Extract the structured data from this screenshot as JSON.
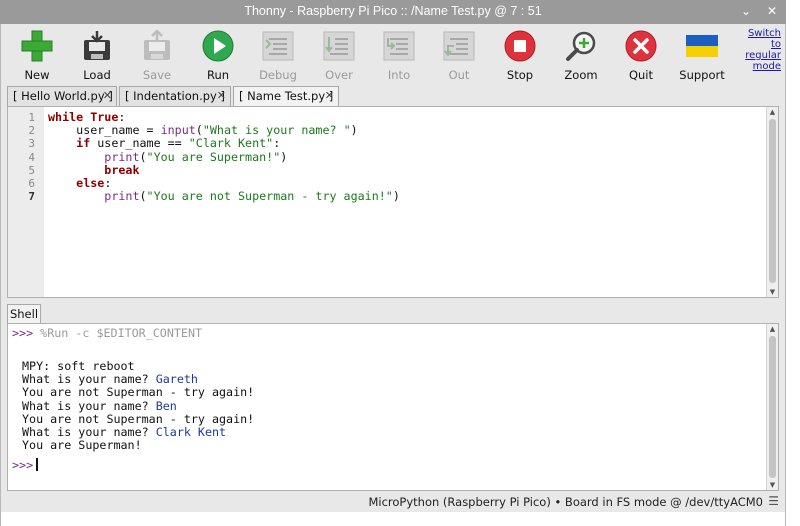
{
  "window": {
    "title": "Thonny  -  Raspberry Pi Pico :: /Name Test.py  @  7 : 51",
    "minimize_glyph": "⌄",
    "close_glyph": "✕"
  },
  "toolbar": {
    "new_label": "New",
    "load_label": "Load",
    "save_label": "Save",
    "run_label": "Run",
    "debug_label": "Debug",
    "over_label": "Over",
    "into_label": "Into",
    "out_label": "Out",
    "stop_label": "Stop",
    "zoom_label": "Zoom",
    "quit_label": "Quit",
    "support_label": "Support",
    "switch_mode_line1": "Switch to",
    "switch_mode_line2": "regular",
    "switch_mode_line3": "mode",
    "icons": [
      "plus-icon",
      "load-icon",
      "save-icon",
      "run-icon",
      "debug-icon",
      "step-over-icon",
      "step-into-icon",
      "step-out-icon",
      "stop-icon",
      "zoom-icon",
      "quit-icon",
      "ukraine-flag-icon"
    ],
    "colors": {
      "new": "#3aaa35",
      "run": "#2fa84f",
      "stop": "#e0323c",
      "quit": "#e0323c",
      "flag_blue": "#1c5fc0",
      "flag_yellow": "#f5d000"
    }
  },
  "tabs": [
    {
      "label": "[ Hello World.py ]",
      "close": "✕",
      "active": false
    },
    {
      "label": "[ Indentation.py ]",
      "close": "✕",
      "active": false
    },
    {
      "label": "[ Name Test.py ]",
      "close": "✕",
      "active": true
    }
  ],
  "editor": {
    "line_numbers": [
      "1",
      "2",
      "3",
      "4",
      "5",
      "6",
      "7"
    ],
    "lines": [
      {
        "indent": "",
        "parts": [
          {
            "t": "while True",
            "c": "kw"
          },
          {
            "t": ":",
            "c": ""
          }
        ]
      },
      {
        "indent": "    ",
        "parts": [
          {
            "t": "user_name = ",
            "c": ""
          },
          {
            "t": "input",
            "c": "bi"
          },
          {
            "t": "(",
            "c": ""
          },
          {
            "t": "\"What is your name? \"",
            "c": "str"
          },
          {
            "t": ")",
            "c": ""
          }
        ]
      },
      {
        "indent": "    ",
        "parts": [
          {
            "t": "if",
            "c": "kw"
          },
          {
            "t": " user_name == ",
            "c": ""
          },
          {
            "t": "\"Clark Kent\"",
            "c": "str"
          },
          {
            "t": ":",
            "c": ""
          }
        ]
      },
      {
        "indent": "        ",
        "parts": [
          {
            "t": "print",
            "c": "bi"
          },
          {
            "t": "(",
            "c": ""
          },
          {
            "t": "\"You are Superman!\"",
            "c": "str"
          },
          {
            "t": ")",
            "c": ""
          }
        ]
      },
      {
        "indent": "        ",
        "parts": [
          {
            "t": "break",
            "c": "kw"
          }
        ]
      },
      {
        "indent": "    ",
        "parts": [
          {
            "t": "else",
            "c": "kw"
          },
          {
            "t": ":",
            "c": ""
          }
        ]
      },
      {
        "indent": "        ",
        "parts": [
          {
            "t": "print",
            "c": "bi"
          },
          {
            "t": "(",
            "c": ""
          },
          {
            "t": "\"You are not Superman - try again!\"",
            "c": "str"
          },
          {
            "t": ")",
            "c": ""
          }
        ]
      }
    ]
  },
  "shell": {
    "tab_label": "Shell",
    "prompt": ">>>",
    "run_command": "%Run -c $EDITOR_CONTENT",
    "output": [
      {
        "text": "MPY: soft reboot",
        "input": ""
      },
      {
        "text": "What is your name? ",
        "input": "Gareth"
      },
      {
        "text": "You are not Superman - try again!",
        "input": ""
      },
      {
        "text": "What is your name? ",
        "input": "Ben"
      },
      {
        "text": "You are not Superman - try again!",
        "input": ""
      },
      {
        "text": "What is your name? ",
        "input": "Clark Kent"
      },
      {
        "text": "You are Superman!",
        "input": ""
      }
    ]
  },
  "status_bar": {
    "text": "MicroPython (Raspberry Pi Pico)  •  Board in FS mode @ /dev/ttyACM0",
    "menu_glyph": "☰"
  }
}
